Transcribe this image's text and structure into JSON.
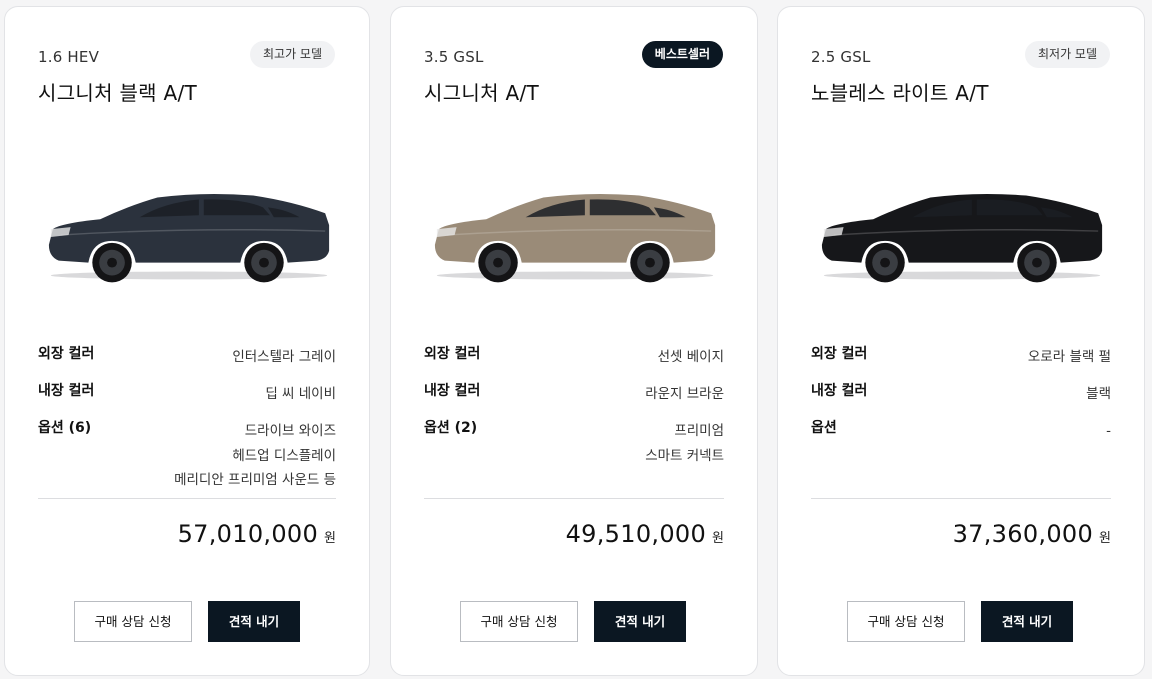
{
  "cards": [
    {
      "trim": "1.6 HEV",
      "model": "시그니처 블랙 A/T",
      "badge": "최고가 모델",
      "badge_style": "light",
      "car_color": "#2b323d",
      "specs": {
        "exterior_label": "외장 컬러",
        "exterior_value": "인터스텔라 그레이",
        "interior_label": "내장 컬러",
        "interior_value": "딥 씨 네이비",
        "options_label": "옵션 (6)",
        "options_values": [
          "드라이브 와이즈",
          "헤드업 디스플레이",
          "메리디안 프리미엄 사운드 등"
        ]
      },
      "price": "57,010,000",
      "currency": "원",
      "consult_label": "구매 상담 신청",
      "quote_label": "견적 내기"
    },
    {
      "trim": "3.5 GSL",
      "model": "시그니처 A/T",
      "badge": "베스트셀러",
      "badge_style": "dark",
      "car_color": "#9a8b78",
      "specs": {
        "exterior_label": "외장 컬러",
        "exterior_value": "선셋 베이지",
        "interior_label": "내장 컬러",
        "interior_value": "라운지 브라운",
        "options_label": "옵션 (2)",
        "options_values": [
          "프리미엄",
          "스마트 커넥트"
        ]
      },
      "price": "49,510,000",
      "currency": "원",
      "consult_label": "구매 상담 신청",
      "quote_label": "견적 내기"
    },
    {
      "trim": "2.5 GSL",
      "model": "노블레스 라이트 A/T",
      "badge": "최저가 모델",
      "badge_style": "light",
      "car_color": "#16171a",
      "specs": {
        "exterior_label": "외장 컬러",
        "exterior_value": "오로라 블랙 펄",
        "interior_label": "내장 컬러",
        "interior_value": "블랙",
        "options_label": "옵션",
        "options_values": [
          "-"
        ]
      },
      "price": "37,360,000",
      "currency": "원",
      "consult_label": "구매 상담 신청",
      "quote_label": "견적 내기"
    }
  ]
}
